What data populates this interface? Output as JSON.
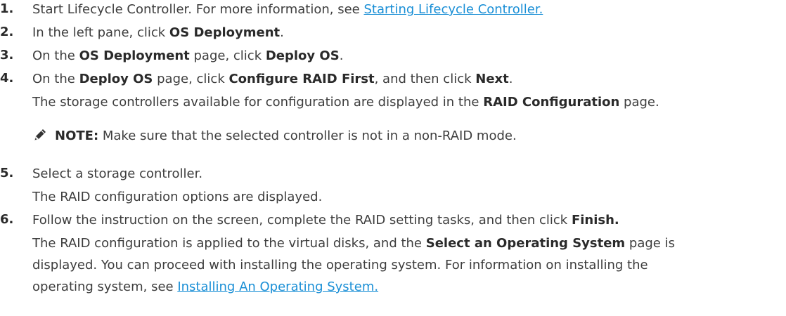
{
  "steps": [
    {
      "number": "1.",
      "text_before": "Start Lifecycle Controller. For more information, see ",
      "link": "Starting Lifecycle Controller."
    },
    {
      "number": "2.",
      "text_before": "In the left pane, click ",
      "bold1": "OS Deployment",
      "text_after": "."
    },
    {
      "number": "3.",
      "text_before": "On the ",
      "bold1": "OS Deployment",
      "text_mid": " page, click ",
      "bold2": "Deploy OS",
      "text_after": "."
    },
    {
      "number": "4.",
      "text_before": "On the ",
      "bold1": "Deploy OS",
      "text_mid1": " page, click ",
      "bold2": "Configure RAID First",
      "text_mid2": ", and then click ",
      "bold3": "Next",
      "text_after": ".",
      "result_before": "The storage controllers available for configuration are displayed in the ",
      "result_bold": "RAID Configuration",
      "result_after": " page.",
      "note_label": "NOTE:",
      "note_text": " Make sure that the selected controller is not in a non-RAID mode."
    },
    {
      "number": "5.",
      "text": "Select a storage controller.",
      "result": "The RAID configuration options are displayed."
    },
    {
      "number": "6.",
      "text_before": "Follow the instruction on the screen, complete the RAID setting tasks, and then click ",
      "bold1": "Finish.",
      "result_line1_before": "The RAID configuration is applied to the virtual disks, and the ",
      "result_line1_bold": "Select an Operating System",
      "result_line1_after": " page is",
      "result_line2": "displayed. You can proceed with installing the operating system. For information on installing the",
      "result_line3_before": "operating system, see ",
      "result_line3_link": "Installing An Operating System."
    }
  ],
  "colors": {
    "text": "#3d3d3d",
    "bold": "#2a2a2a",
    "link": "#1a8fd6"
  },
  "icons": {
    "note": "pencil-note-icon"
  }
}
